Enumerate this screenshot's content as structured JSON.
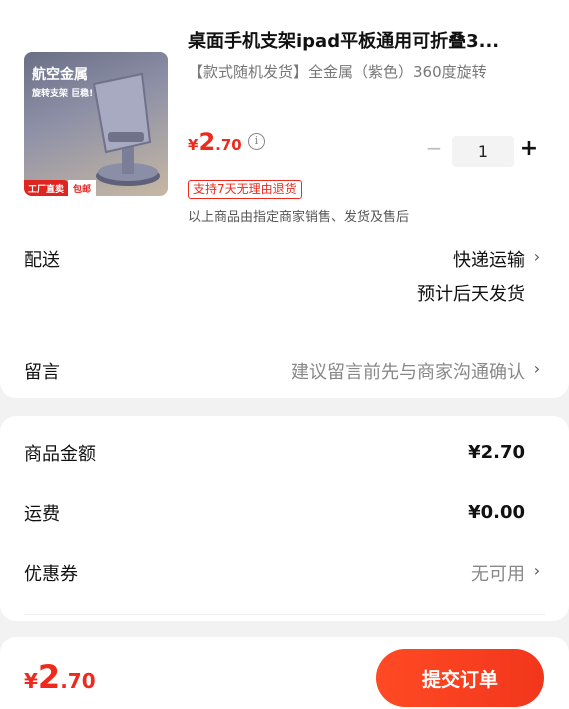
{
  "product": {
    "title": "桌面手机支架ipad平板通用可折叠3...",
    "spec": "【款式随机发货】全金属（紫色）360度旋转",
    "price_currency": "¥",
    "price_int": "2",
    "price_dec": ".70",
    "quantity": "1",
    "minus_label": "−",
    "plus_label": "+",
    "return_badge": "支持7天无理由退货",
    "seller_note": "以上商品由指定商家销售、发货及售后",
    "image": {
      "title": "航空金属",
      "subtitle": "旋转支架 巨稳!",
      "tag_factory": "工厂直卖",
      "tag_shipping": "包邮"
    }
  },
  "delivery": {
    "label": "配送",
    "method": "快递运输",
    "estimate": "预计后天发货"
  },
  "message": {
    "label": "留言",
    "placeholder": "建议留言前先与商家沟通确认"
  },
  "summary": {
    "goods_label": "商品金额",
    "goods_value": "¥2.70",
    "shipping_label": "运费",
    "shipping_value": "¥0.00",
    "coupon_label": "优惠券",
    "coupon_value": "无可用"
  },
  "footer": {
    "total_currency": "¥",
    "total_int": "2",
    "total_dec": ".70",
    "submit_label": "提交订单"
  },
  "colors": {
    "accent": "#ee2a1e",
    "background": "#f2f2f2"
  }
}
